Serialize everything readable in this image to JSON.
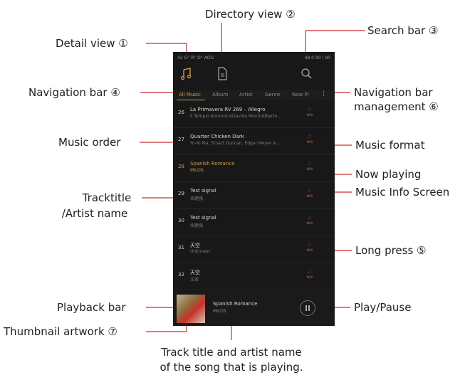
{
  "annotations": {
    "directory_view": "Directory view ②",
    "detail_view": "Detail view ①",
    "search_bar": "Search bar ③",
    "navigation_bar": "Navigation bar ④",
    "nav_mgmt_line1": "Navigation bar",
    "nav_mgmt_line2": "management ⑥",
    "music_order": "Music order",
    "music_format": "Music format",
    "now_playing": "Now playing",
    "music_info_screen": "Music Info Screen",
    "tracktitle_line1": "Tracktitle",
    "tracktitle_line2": "/Artist name",
    "long_press": "Long press ⑤",
    "playback_bar": "Playback bar",
    "play_pause": "Play/Pause",
    "thumbnail_artwork": "Thumbnail artwork ⑦",
    "track_title_line1": "Track title and artist name",
    "track_title_line2": "of the song that is playing."
  },
  "status_bar": {
    "left": "42 G° R° D° AOG",
    "right": "48.0  90 | 90"
  },
  "nav_tabs": [
    "All Music",
    "Album",
    "Artist",
    "Genre",
    "Now Pl"
  ],
  "nav_more": "⋮",
  "tracks": [
    {
      "num": "26",
      "title": "La Primavera RV 269 – Allegro",
      "artist": "Il Tempio Armonico/Davide Monti/Alberto...",
      "format": "WAV"
    },
    {
      "num": "27",
      "title": "Quarter Chicken Dark",
      "artist": "Yo-Yo Ma, Stuart Duncan, Edgar Meyer &...",
      "format": "WAV"
    },
    {
      "num": "28",
      "title": "Spanish Romance",
      "artist": "MILOS",
      "format": "WAV",
      "playing": true
    },
    {
      "num": "29",
      "title": "Test signal",
      "artist": "幸建强",
      "format": "WAV"
    },
    {
      "num": "30",
      "title": "Test signal",
      "artist": "幸建强",
      "format": "WAV"
    },
    {
      "num": "31",
      "title": "天空",
      "artist": "Unknown",
      "format": "WAV"
    },
    {
      "num": "32",
      "title": "天空",
      "artist": "王菲",
      "format": "WAV"
    }
  ],
  "now_playing": {
    "title": "Spanish Romance",
    "artist": "MILOS"
  },
  "colors": {
    "accent": "#d49a4a",
    "annotation_line": "#cc2a2a",
    "background": "#181818"
  }
}
